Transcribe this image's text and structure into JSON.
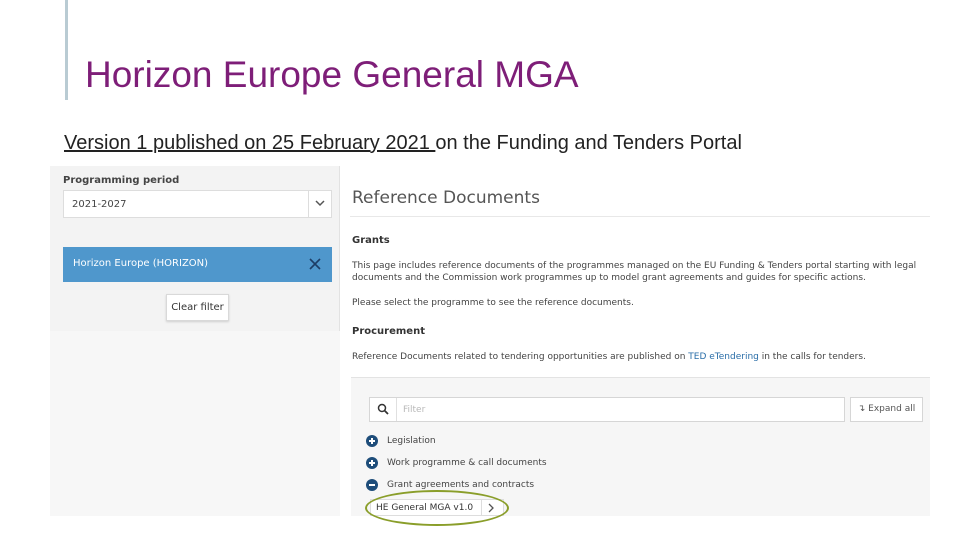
{
  "slide": {
    "title": "Horizon Europe General MGA",
    "subtitle_link": "Version 1 published on 25 February 2021 ",
    "subtitle_rest": "on the Funding and Tenders Portal",
    "title_color": "#7e1e78",
    "highlight_color": "#8a9e2a"
  },
  "filter": {
    "programming_period_label": "Programming period",
    "programming_period_value": "2021-2027",
    "active_filter": "Horizon Europe (HORIZON)",
    "clear_filter_label": "Clear filter",
    "chip_color": "#4f97cc"
  },
  "content": {
    "heading": "Reference Documents",
    "grants_heading": "Grants",
    "grants_text": "This page includes reference documents of the programmes managed on the EU Funding & Tenders portal starting with legal documents and the Commission work programmes up to model grant agreements and guides for specific actions.",
    "select_text": "Please select the programme to see the reference documents.",
    "procurement_heading": "Procurement",
    "procurement_text_before": "Reference Documents related to tendering opportunities are published on ",
    "procurement_link": "TED eTendering",
    "procurement_text_after": " in the calls for tenders."
  },
  "tree": {
    "filter_placeholder": "Filter",
    "expand_all_label": "Expand all",
    "items": [
      {
        "label": "Legislation",
        "state": "collapsed"
      },
      {
        "label": "Work programme & call documents",
        "state": "collapsed"
      },
      {
        "label": "Grant agreements and contracts",
        "state": "expanded"
      }
    ],
    "selected_leaf": "HE General MGA v1.0"
  }
}
